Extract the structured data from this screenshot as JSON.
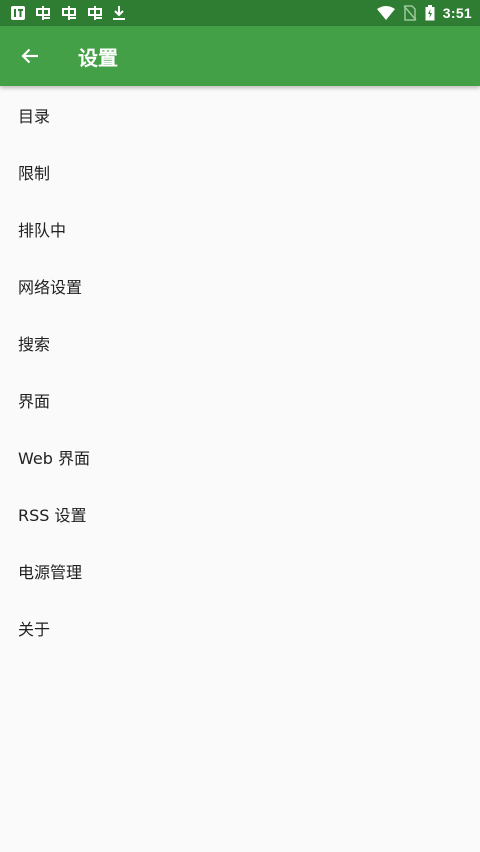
{
  "status_bar": {
    "left_icons": [
      "notification-app-icon",
      "bug-icon",
      "bug-icon",
      "bug-icon",
      "download-icon"
    ],
    "right_icons": [
      "wifi-icon",
      "no-sim-icon",
      "battery-icon"
    ],
    "time": "3:51",
    "color": "#2f7d32"
  },
  "app_bar": {
    "title": "设置",
    "back_icon": "arrow-back-icon",
    "color": "#43a047"
  },
  "settings": {
    "items": [
      {
        "label": "目录"
      },
      {
        "label": "限制"
      },
      {
        "label": "排队中"
      },
      {
        "label": "网络设置"
      },
      {
        "label": "搜索"
      },
      {
        "label": "界面"
      },
      {
        "label": "Web 界面"
      },
      {
        "label": "RSS 设置"
      },
      {
        "label": "电源管理"
      },
      {
        "label": "关于"
      }
    ]
  }
}
